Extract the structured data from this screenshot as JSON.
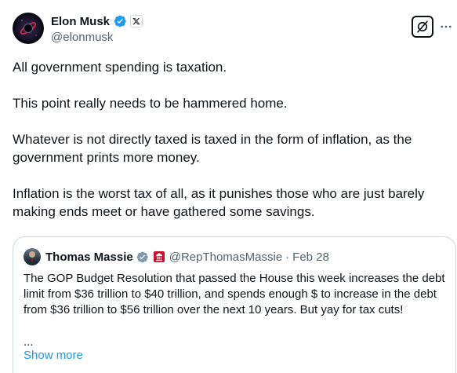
{
  "author": {
    "display_name": "Elon Musk",
    "handle": "@elonmusk",
    "verified_icon": "verified-badge-icon",
    "affiliation_icon": "x-logo-icon",
    "avatar_icon": "avatar"
  },
  "actions": {
    "grok_icon": "grok-icon",
    "more_icon": "more-options-icon"
  },
  "tweet": {
    "paragraphs": [
      "All government spending is taxation.",
      "This point really needs to be hammered home.",
      "Whatever is not directly taxed is taxed in the form of inflation, as the government prints more money.",
      "Inflation is the worst tax of all, as it punishes those who are just barely making ends meet or have gathered some savings."
    ]
  },
  "quote": {
    "display_name": "Thomas Massie",
    "handle": "@RepThomasMassie",
    "separator": "·",
    "date": "Feb 28",
    "text": "The GOP Budget Resolution that passed the House this week increases the debt limit from $36 trillion to $40 trillion, and spends enough $ to increase in the debt from $36 trillion to $56 trillion over the next 10 years. But yay for tax cuts!",
    "ellipsis": "...",
    "show_more": "Show more"
  },
  "colors": {
    "text": "#0f1419",
    "secondary": "#536471",
    "link": "#1d9bf0",
    "verified_blue": "#1d9bf0",
    "verified_gray": "#829aab",
    "border": "#cfd9de",
    "gov_red": "#c8102e"
  }
}
